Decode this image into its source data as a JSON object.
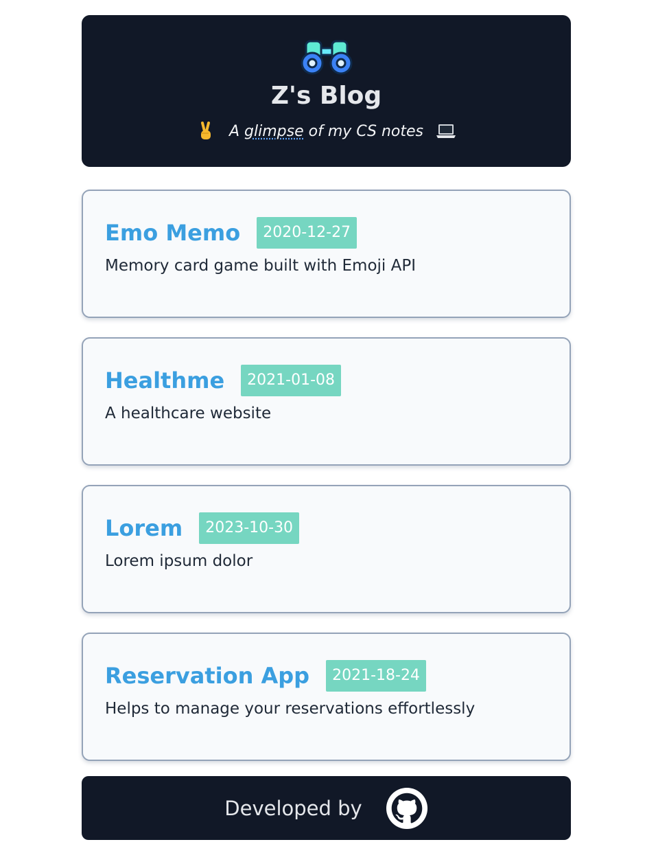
{
  "header": {
    "icon": "binoculars-icon",
    "title": "Z's Blog",
    "tagline_prefix": "A ",
    "tagline_abbr": "glimpse",
    "tagline_suffix": " of my CS notes",
    "left_emoji": "victory-hand-icon",
    "right_emoji": "laptop-icon"
  },
  "posts": [
    {
      "title": "Emo Memo",
      "date": "2020-12-27",
      "description": "Memory card game built with Emoji API"
    },
    {
      "title": "Healthme",
      "date": "2021-01-08",
      "description": "A healthcare website"
    },
    {
      "title": "Lorem",
      "date": "2023-10-30",
      "description": "Lorem ipsum dolor"
    },
    {
      "title": "Reservation App",
      "date": "2021-18-24",
      "description": "Helps to manage your reservations effortlessly"
    }
  ],
  "footer": {
    "text": "Developed by",
    "icon": "github-icon"
  },
  "colors": {
    "header_bg": "#111827",
    "title_blue": "#3b9fe0",
    "date_badge": "#76d6c1",
    "card_bg": "#f8fafc",
    "card_border": "#94a3b8"
  }
}
